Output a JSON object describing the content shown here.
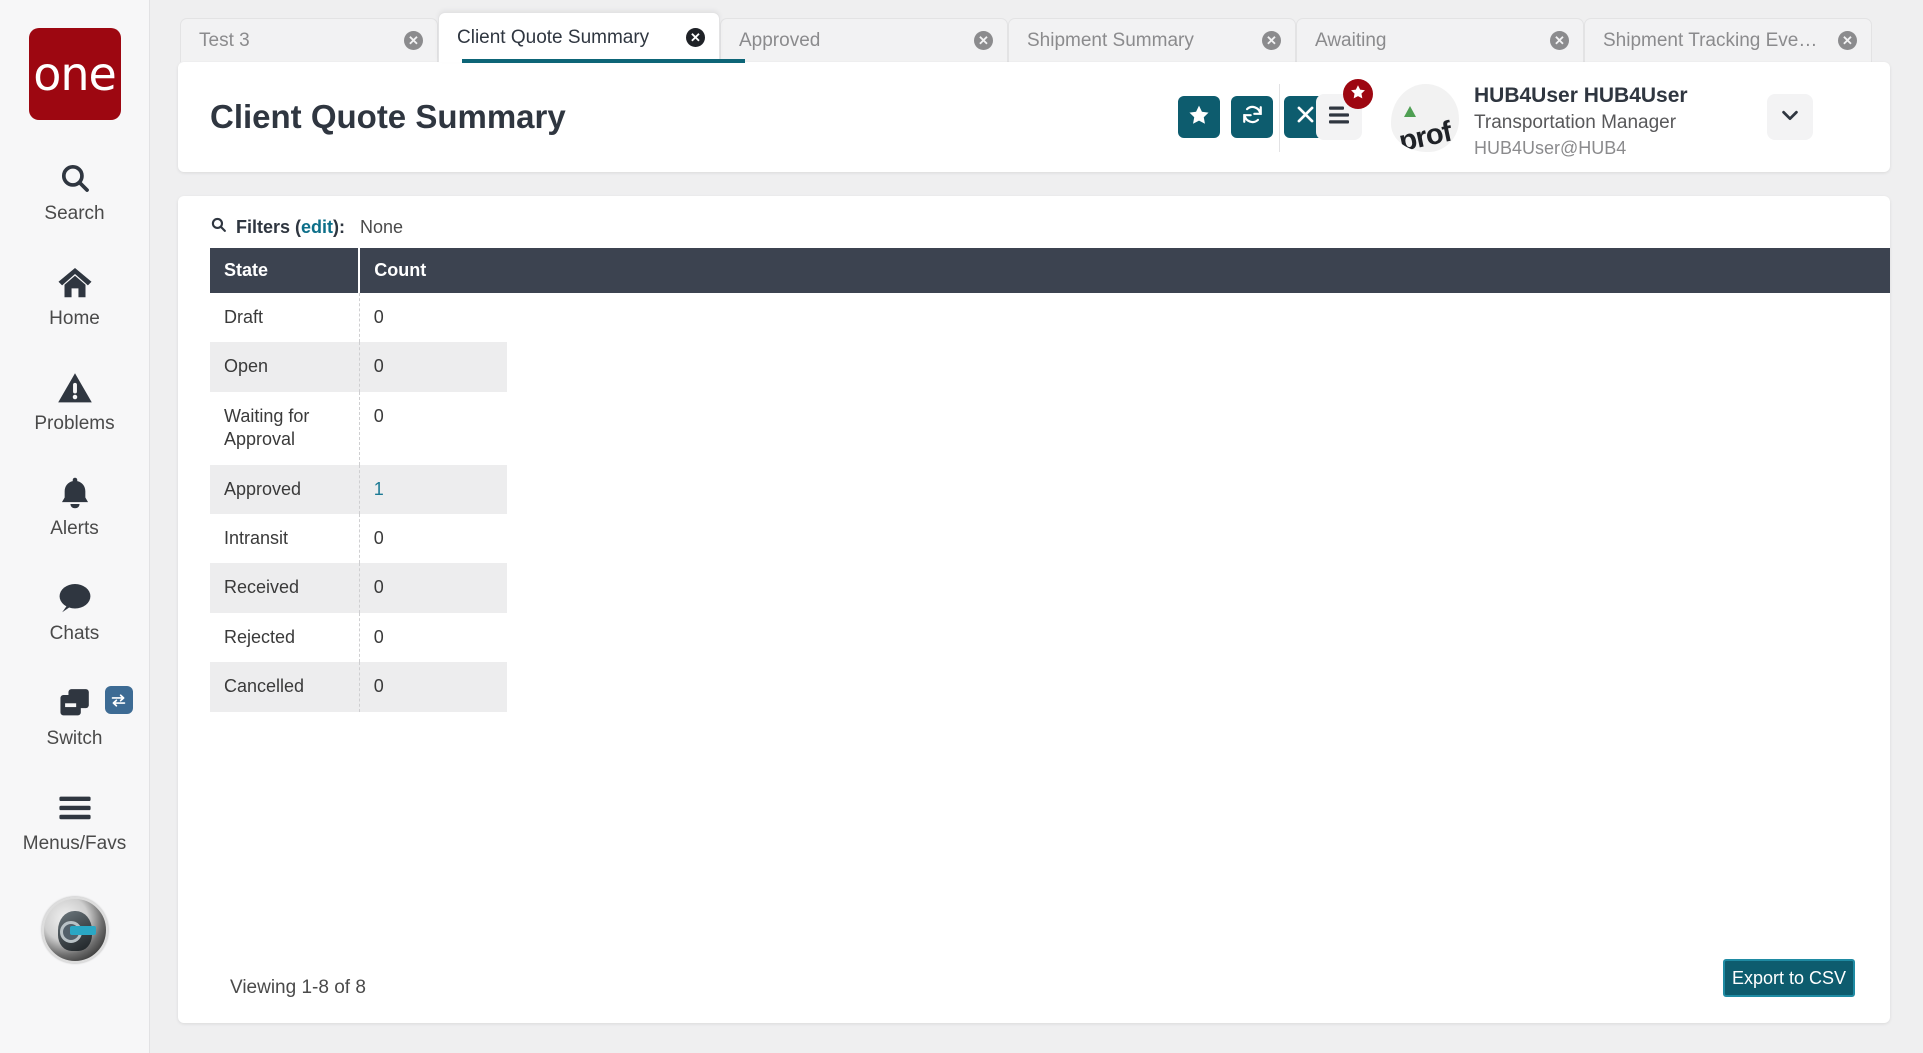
{
  "brand": {
    "logo_text": "one"
  },
  "sidebar": {
    "items": [
      {
        "label": "Search",
        "icon": "search-icon"
      },
      {
        "label": "Home",
        "icon": "home-icon"
      },
      {
        "label": "Problems",
        "icon": "warning-triangle-icon"
      },
      {
        "label": "Alerts",
        "icon": "bell-icon"
      },
      {
        "label": "Chats",
        "icon": "chat-bubble-icon"
      },
      {
        "label": "Switch",
        "icon": "switch-windows-icon",
        "badge_icon": "exchange-arrows-icon"
      },
      {
        "label": "Menus/Favs",
        "icon": "hamburger-icon"
      }
    ],
    "bot_avatar": "bot-avatar-icon"
  },
  "tabs": [
    {
      "label": "Test 3",
      "active": false,
      "close_icon": "close-circle-icon"
    },
    {
      "label": "Client Quote Summary",
      "active": true,
      "close_icon": "close-circle-icon"
    },
    {
      "label": "Approved",
      "active": false,
      "close_icon": "close-circle-icon"
    },
    {
      "label": "Shipment Summary",
      "active": false,
      "close_icon": "close-circle-icon"
    },
    {
      "label": "Awaiting",
      "active": false,
      "close_icon": "close-circle-icon"
    },
    {
      "label": "Shipment Tracking Event R...",
      "active": false,
      "close_icon": "close-circle-icon"
    }
  ],
  "header": {
    "title": "Client Quote Summary",
    "actions": [
      {
        "name": "favorite-button",
        "icon": "star-icon"
      },
      {
        "name": "refresh-button",
        "icon": "refresh-icon"
      },
      {
        "name": "close-button",
        "icon": "x-icon"
      }
    ],
    "menus_favs_icon": "hamburger-list-icon",
    "menus_favs_badge_icon": "star-icon",
    "avatar_placeholder_text": "prof",
    "user": {
      "name": "HUB4User HUB4User",
      "role": "Transportation Manager",
      "email": "HUB4User@HUB4"
    },
    "caret_icon": "chevron-down-icon"
  },
  "filters": {
    "search_icon": "search-icon",
    "label": "Filters (",
    "edit_label": "edit",
    "label_suffix": "):",
    "value": "None"
  },
  "table": {
    "columns": [
      "State",
      "Count"
    ],
    "rows": [
      {
        "state": "Draft",
        "count": "0",
        "is_link": false
      },
      {
        "state": "Open",
        "count": "0",
        "is_link": false
      },
      {
        "state": "Waiting for Approval",
        "count": "0",
        "is_link": false
      },
      {
        "state": "Approved",
        "count": "1",
        "is_link": true
      },
      {
        "state": "Intransit",
        "count": "0",
        "is_link": false
      },
      {
        "state": "Received",
        "count": "0",
        "is_link": false
      },
      {
        "state": "Rejected",
        "count": "0",
        "is_link": false
      },
      {
        "state": "Cancelled",
        "count": "0",
        "is_link": false
      }
    ]
  },
  "footer": {
    "viewing": "Viewing 1-8 of 8",
    "export_label": "Export to CSV"
  },
  "colors": {
    "brand_red": "#9d0711",
    "teal_action": "#0d5c6e",
    "tab_accent": "#0d6577",
    "table_header": "#3c4350",
    "link": "#1c7a94",
    "switch_badge": "#3d6b94"
  }
}
